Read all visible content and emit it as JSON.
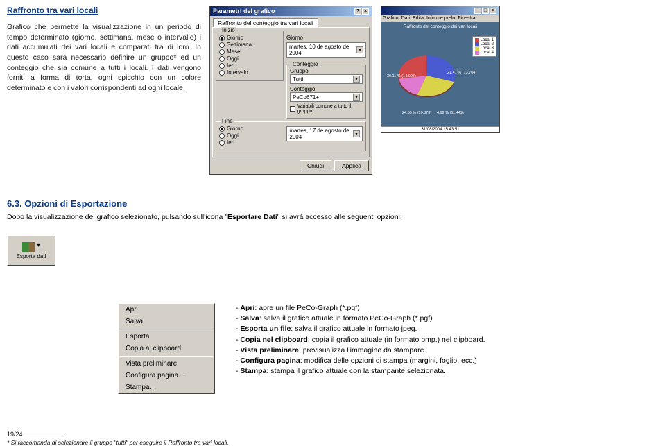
{
  "section1": {
    "title": "Raffronto tra vari locali",
    "paragraph": "Grafico che permette la visualizzazione in un periodo di tempo determinato (giorno, settimana, mese o intervallo) i dati accumulati dei vari locali e comparati tra di loro. In questo caso sarà necessario definire un gruppo* ed un conteggio che sia comune a tutti i locali. I dati vengono forniti a forma di torta, ogni spicchio con un colore determinato e con i valori corrispondenti ad ogni locale."
  },
  "dialog": {
    "title": "Parametri del grafico",
    "tab": "Raffronto del conteggio tra vari locali",
    "group_inizio": "Inizio",
    "group_fine": "Fine",
    "group_conteggio": "Conteggio",
    "radio_giorno": "Giorno",
    "radio_settimana": "Settimana",
    "radio_mese": "Mese",
    "radio_oggi": "Oggi",
    "radio_ieri": "Ieri",
    "radio_intervalo": "Intervalo",
    "field_giorno1": "Giorno",
    "date1": "martes, 10 de agosto de 2004",
    "date2": "martes, 17 de agosto de 2004",
    "lbl_gruppo": "Gruppo",
    "val_gruppo": "Tutti",
    "lbl_conteggio": "Conteggio",
    "val_conteggio": "PeCo671+",
    "cb_label": "Variabili comune a tutto il gruppo",
    "btn_chiudi": "Chiudi",
    "btn_applica": "Applica"
  },
  "piewin": {
    "menu": [
      "Grafico",
      "Dati",
      "Edita",
      "Informe prelo",
      "Finestra",
      "?"
    ],
    "title": "Raffronto del conteggio dei vari locali",
    "legend": [
      "Local 1",
      "Local 2",
      "Local 3",
      "Local 4"
    ],
    "slice_labels": [
      "30.11 % (14.097)",
      "21.41 % (13.704)",
      "24.59 % (10.873)",
      "4.99 % (11.449)"
    ],
    "status": "31/08/2004 15:43:51"
  },
  "chart_data": {
    "type": "pie",
    "title": "Raffronto del conteggio dei vari locali",
    "series": [
      {
        "name": "Local 1",
        "percent": 30.11,
        "value": 14097,
        "color": "#d04848"
      },
      {
        "name": "Local 2",
        "percent": 21.41,
        "value": 13704,
        "color": "#4a5ad0"
      },
      {
        "name": "Local 3",
        "percent": 24.59,
        "value": 10873,
        "color": "#d9d34a"
      },
      {
        "name": "Local 4",
        "percent": 4.99,
        "value": 11449,
        "color": "#e07ad0"
      }
    ]
  },
  "section63": {
    "heading": "6.3. Opzioni di Esportazione",
    "intro_a": "Dopo la visualizzazione del grafico selezionato, pulsando sull'icona \"",
    "intro_b": "Esportare Dati",
    "intro_c": "\" si avrà accesso alle seguenti opzioni:"
  },
  "esporta_btn": {
    "label": "Esporta dati"
  },
  "ctxmenu": {
    "apri": "Apri",
    "salva": "Salva",
    "esporta": "Esporta",
    "copia": "Copia al clipboard",
    "vista": "Vista preliminare",
    "config": "Configura pagina…",
    "stampa": "Stampa…"
  },
  "bullets": {
    "apri_b": "Apri",
    "apri_t": ": apre un file PeCo-Graph (*.pgf)",
    "salva_b": "Salva",
    "salva_t": ": salva il grafico attuale in formato PeCo-Graph (*.pgf)",
    "esporta_b": "Esporta un file",
    "esporta_t": ": salva il grafico attuale in formato jpeg.",
    "copia_b": "Copia nel clipboard",
    "copia_t": ": copia il grafico attuale (in formato bmp.) nel clipboard.",
    "vista_b": "Vista preliminare",
    "vista_t": ": previsualizza l'immagine da stampare.",
    "config_b": "Configura pagina",
    "config_t": ": modifica delle opzioni di stampa (margini, foglio, ecc.)",
    "stampa_b": "Stampa",
    "stampa_t": ": stampa il grafico attuale con la stampante selezionata."
  },
  "footnote": "* Si raccomanda di selezionare il gruppo \"tutti\" per eseguire il Raffronto tra vari locali.",
  "pagenum": "19/24"
}
